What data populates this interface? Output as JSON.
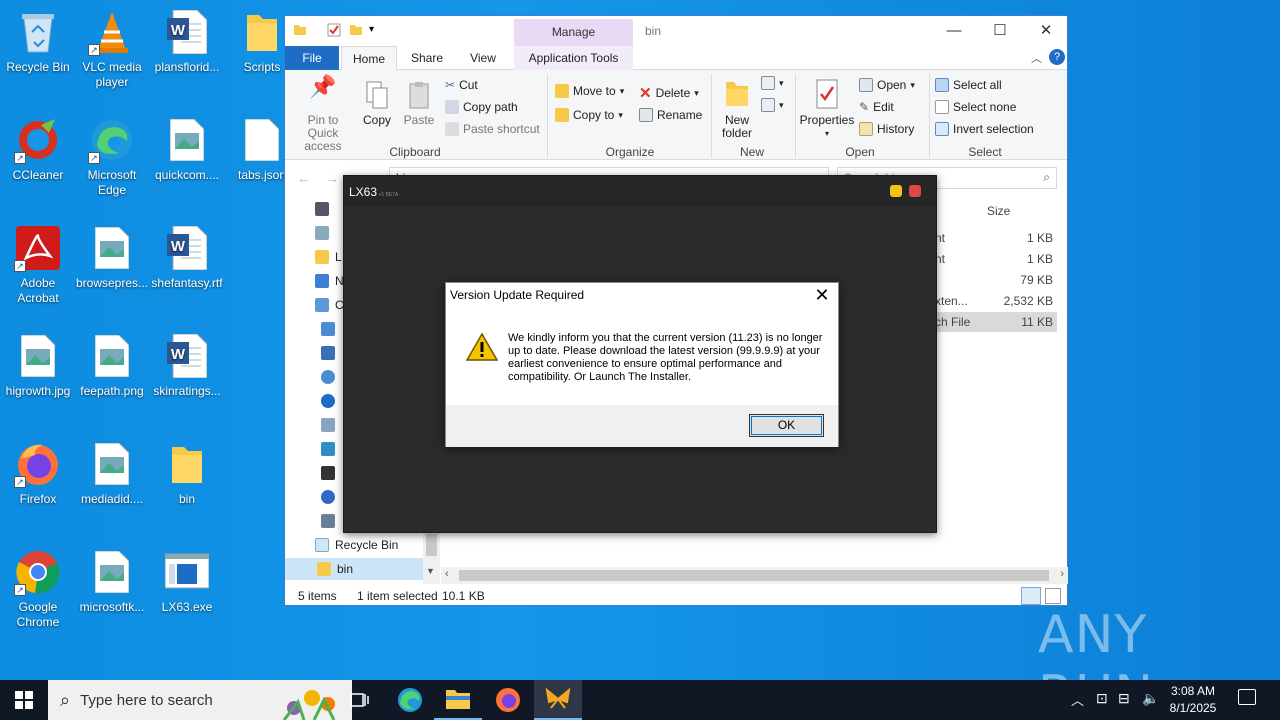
{
  "desktop": {
    "icons": [
      {
        "label": "Recycle Bin"
      },
      {
        "label": "VLC media player"
      },
      {
        "label": "plansflorid..."
      },
      {
        "label": "Scripts"
      },
      {
        "label": "CCleaner"
      },
      {
        "label": "Microsoft Edge"
      },
      {
        "label": "quickcom...."
      },
      {
        "label": "tabs.json"
      },
      {
        "label": "Adobe Acrobat"
      },
      {
        "label": "browsepres..."
      },
      {
        "label": "shefantasy.rtf"
      },
      {
        "label": "higrowth.jpg"
      },
      {
        "label": "feepath.png"
      },
      {
        "label": "skinratings..."
      },
      {
        "label": "Firefox"
      },
      {
        "label": "mediadid...."
      },
      {
        "label": "bin"
      },
      {
        "label": "Google Chrome"
      },
      {
        "label": "microsoftk..."
      },
      {
        "label": "LX63.exe"
      }
    ],
    "watermark": "ANY RUN"
  },
  "explorer": {
    "title": "bin",
    "manage_tab": "Manage",
    "tabs": [
      "File",
      "Home",
      "Share",
      "View",
      "Application Tools"
    ],
    "ribbon": {
      "clipboard": {
        "pin": "Pin to Quick access",
        "copy": "Copy",
        "paste": "Paste",
        "cut": "Cut",
        "copy_path": "Copy path",
        "paste_shortcut": "Paste shortcut",
        "group": "Clipboard"
      },
      "organize": {
        "move_to": "Move to",
        "copy_to": "Copy to",
        "delete": "Delete",
        "rename": "Rename",
        "group": "Organize"
      },
      "new": {
        "new_folder": "New folder",
        "group": "New"
      },
      "open": {
        "properties": "Properties",
        "open": "Open",
        "edit": "Edit",
        "history": "History",
        "group": "Open"
      },
      "select": {
        "select_all": "Select all",
        "select_none": "Select none",
        "invert": "Invert selection",
        "group": "Select"
      }
    },
    "address_partial": "bin",
    "search_partial": "Search bin",
    "nav_items": [
      "L",
      "N",
      "C",
      "Recycle Bin",
      "bin"
    ],
    "column_size": "Size",
    "rows": [
      {
        "type": "nt",
        "size": "1 KB"
      },
      {
        "type": "nt",
        "size": "1 KB"
      },
      {
        "type": "",
        "size": "79 KB"
      },
      {
        "type": "xten...",
        "size": "2,532 KB"
      },
      {
        "type": "ch File",
        "size": "11 KB"
      }
    ],
    "status": {
      "items": "5 items",
      "selected": "1 item selected",
      "size": "10.1 KB"
    }
  },
  "lx63": {
    "title": "LX63",
    "subtitle": "v1 BETA",
    "colors": {
      "min": "#f0c419",
      "close": "#e04848"
    }
  },
  "dialog": {
    "title": "Version Update Required",
    "message": "We kindly inform you that the current version (11.23) is no longer up to date. Please download the latest version (99.9.9.9) at your earliest convenience to ensure optimal performance and compatibility. Or Launch The Installer.",
    "ok": "OK"
  },
  "taskbar": {
    "search_placeholder": "Type here to search",
    "time": "3:08 AM",
    "date": "8/1/2025"
  }
}
